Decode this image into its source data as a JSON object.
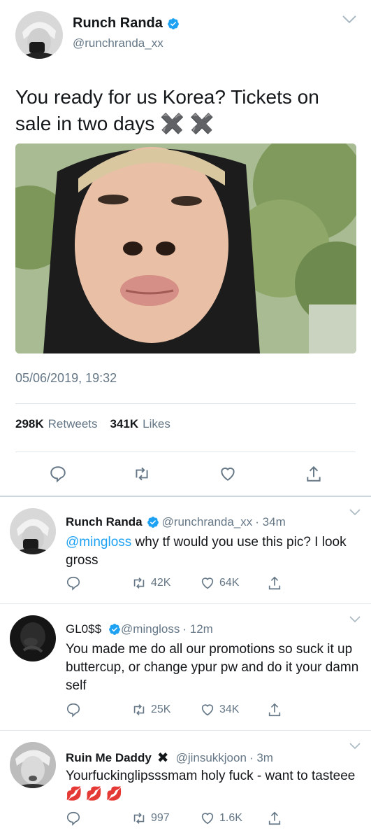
{
  "main_tweet": {
    "display_name": "Runch Randa",
    "handle": "@runchranda_xx",
    "text": "You ready for us Korea? Tickets on sale in two days ✖️ ✖️",
    "timestamp": "05/06/2019, 19:32",
    "retweets_count": "298K",
    "retweets_label": "Retweets",
    "likes_count": "341K",
    "likes_label": "Likes"
  },
  "replies": [
    {
      "display_name": "Runch Randa",
      "handle": "@runchranda_xx",
      "time": "· 34m",
      "mention": "@mingloss",
      "text": " why tf would you use this pic? I look gross",
      "retweets": "42K",
      "likes": "64K"
    },
    {
      "display_name": "GL0$$",
      "handle": "@mingloss",
      "time": "· 12m",
      "text": "You made me do all our promotions so suck it up buttercup, or change ypur pw and do it your damn self",
      "retweets": "25K",
      "likes": "34K"
    },
    {
      "display_name": "Ruin Me Daddy",
      "handle": "@jinsukkjoon",
      "time": "· 3m",
      "text": "Yourfuckinglipsssmam holy fuck - want to tasteee 💋 💋 💋",
      "retweets": "997",
      "likes": "1.6K"
    }
  ],
  "colors": {
    "accent": "#1da1f2",
    "text": "#14171a",
    "secondary": "#657786",
    "divider": "#e1e8ed"
  }
}
